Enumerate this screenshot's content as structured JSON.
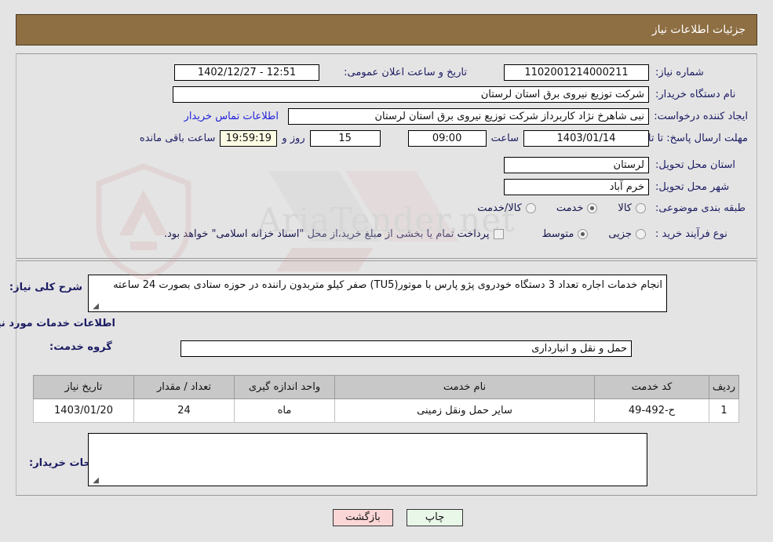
{
  "header": {
    "title": "جزئیات اطلاعات نیاز"
  },
  "top": {
    "need_number_label": "شماره نیاز:",
    "need_number_value": "1102001214000211",
    "announce_label": "تاریخ و ساعت اعلان عمومی:",
    "announce_value": "1402/12/27 - 12:51",
    "buyer_org_label": "نام دستگاه خریدار:",
    "buyer_org_value": "شرکت توزیع نیروی برق استان لرستان",
    "creator_label": "ایجاد کننده درخواست:",
    "creator_value": "نبی شاهرخ نژاد کاربرداز شرکت توزیع نیروی برق استان لرستان",
    "contact_link": "اطلاعات تماس خریدار",
    "deadline_label": "مهلت ارسال پاسخ: تا تاریخ:",
    "deadline_date": "1403/01/14",
    "hour_label": "ساعت",
    "deadline_time": "09:00",
    "days_remaining": "15",
    "days_label": "روز و",
    "countdown": "19:59:19",
    "countdown_label": "ساعت باقی مانده",
    "province_label": "استان محل تحویل:",
    "province_value": "لرستان",
    "city_label": "شهر محل تحویل:",
    "city_value": "خرم آباد",
    "category_label": "طبقه بندی موضوعی:",
    "category_options": [
      {
        "label": "کالا",
        "selected": false
      },
      {
        "label": "خدمت",
        "selected": true
      },
      {
        "label": "کالا/خدمت",
        "selected": false
      }
    ],
    "process_label": "نوع فرآیند خرید :",
    "process_options": [
      {
        "label": "جزیی",
        "selected": false
      },
      {
        "label": "متوسط",
        "selected": true
      }
    ],
    "treasury_checkbox_label": "پرداخت تمام یا بخشی از مبلغ خرید،از محل \"اسناد خزانه اسلامی\" خواهد بود.",
    "treasury_checked": false
  },
  "mid": {
    "summary_label": "شرح کلی نیاز:",
    "summary_value": "انجام خدمات اجاره تعداد 3 دستگاه خودروی  پژو پارس با موتور(TU5)  صفر کیلو متربدون راننده در حوزه ستادی بصورت 24 ساعته",
    "services_heading": "اطلاعات خدمات مورد نیاز",
    "service_group_label": "گروه خدمت:",
    "service_group_value": "حمل و نقل و انبارداری",
    "table": {
      "headers": [
        "ردیف",
        "کد خدمت",
        "نام خدمت",
        "واحد اندازه گیری",
        "تعداد / مقدار",
        "تاریخ نیاز"
      ],
      "rows": [
        [
          "1",
          "ح-492-49",
          "سایر حمل ونقل زمینی",
          "ماه",
          "24",
          "1403/01/20"
        ]
      ]
    },
    "buyer_notes_label": "توضیحات خریدار:",
    "buyer_notes_value": ""
  },
  "footer": {
    "print_button": "چاپ",
    "back_button": "بازگشت"
  },
  "watermark": {
    "text": "AriaTender.net"
  },
  "colors": {
    "header_brown": "#8e6f43",
    "page_bg": "#e4e4e4",
    "label_blue": "#1c1c64",
    "link_blue": "#2222dd",
    "table_header_gray": "#c8c8c8",
    "countdown_yellow": "#fcfce4",
    "print_green": "#e9f7e9",
    "back_pink": "#fbd6d6"
  }
}
